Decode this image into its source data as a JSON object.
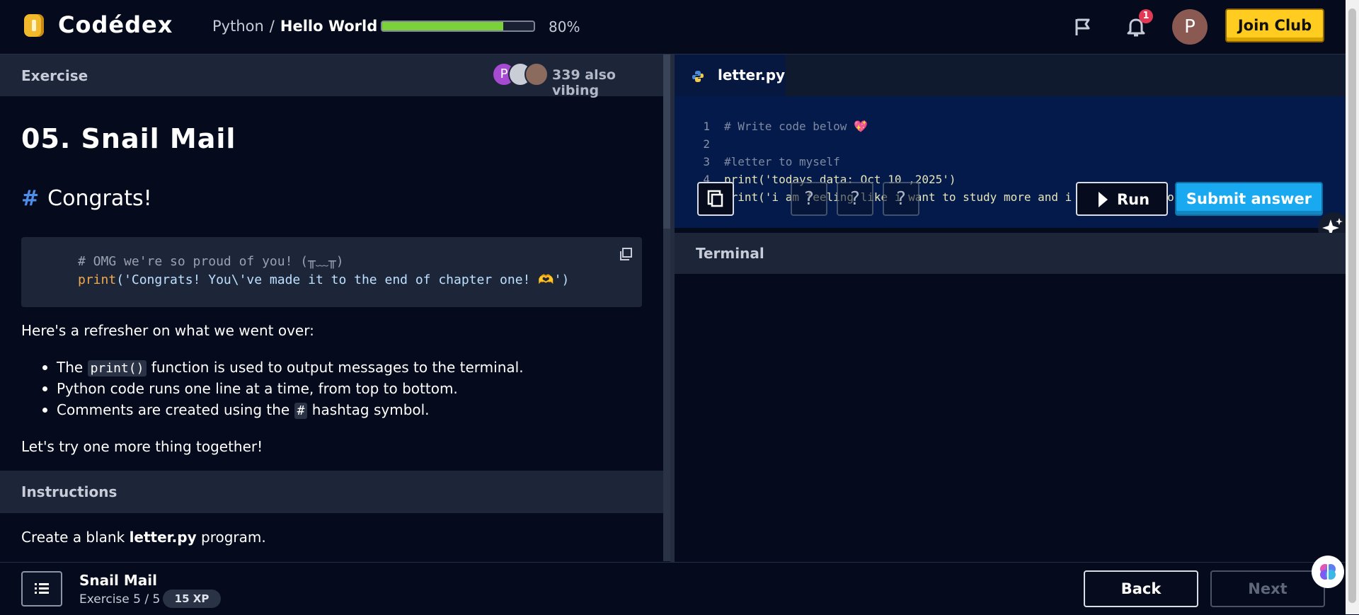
{
  "nav": {
    "logo": "Codédex",
    "breadcrumb": {
      "course": "Python",
      "separator": "/",
      "lesson": "Hello World"
    },
    "progress": {
      "value": 0.8,
      "label": "80%"
    },
    "notification_count": "1",
    "avatar_initial": "P",
    "join_label": "Join Club"
  },
  "exercise": {
    "header": "Exercise",
    "vibing": {
      "avatar_initial": "P",
      "text": "339 also vibing"
    },
    "title": "05. Snail Mail",
    "subtitle_hash": "#",
    "subtitle": "Congrats!",
    "code": {
      "comment": "# OMG we're so proud of you! (╥﹏╥)",
      "line2_kw": "print",
      "line2_rest": "('Congrats! You\\'ve made it to the end of chapter one! 🫶')"
    },
    "refresher": "Here's a refresher on what we went over:",
    "bullets": [
      {
        "pre": "The ",
        "code": "print()",
        "post": " function is used to output messages to the terminal."
      },
      {
        "pre": "Python code runs one line at a time, from top to bottom.",
        "code": "",
        "post": ""
      },
      {
        "pre": "Comments are created using the ",
        "code": "#",
        "post": " hashtag symbol."
      }
    ],
    "try_text": "Let's try one more thing together!",
    "instructions_header": "Instructions",
    "instruction": {
      "pre": "Create a blank ",
      "bold": "letter.py",
      "post": " program."
    }
  },
  "editor": {
    "tab": "letter.py",
    "lines": [
      {
        "n": "1",
        "text": "# Write code below 💖"
      },
      {
        "n": "2",
        "text": ""
      },
      {
        "n": "3",
        "text": "#letter to myself"
      },
      {
        "n": "4",
        "text": "print('todays data: Oct 10 ,2025')"
      },
      {
        "n": "5",
        "text": "print('i am feeling like i want to study more and i am swearing to my sel: that i will"
      }
    ],
    "question_mark": "?",
    "run_label": "Run",
    "submit_label": "Submit answer"
  },
  "terminal": {
    "header": "Terminal"
  },
  "footer": {
    "title": "Snail Mail",
    "subtitle": "Exercise 5 / 5",
    "xp": "15 XP",
    "back_label": "Back",
    "next_label": "Next"
  },
  "colors": {
    "background": "#050a1c",
    "panel_header": "#1d2639",
    "accent_yellow": "#ffcc1f",
    "accent_blue": "#19a9f0",
    "progress_green": "#7bd13a",
    "badge_red": "#e23a55"
  },
  "icons": [
    "coin-logo-icon",
    "flag-icon",
    "bell-icon",
    "copy-icon",
    "python-icon",
    "duplicate-icon",
    "play-icon",
    "sparkle-icon",
    "list-icon",
    "brain-icon"
  ]
}
